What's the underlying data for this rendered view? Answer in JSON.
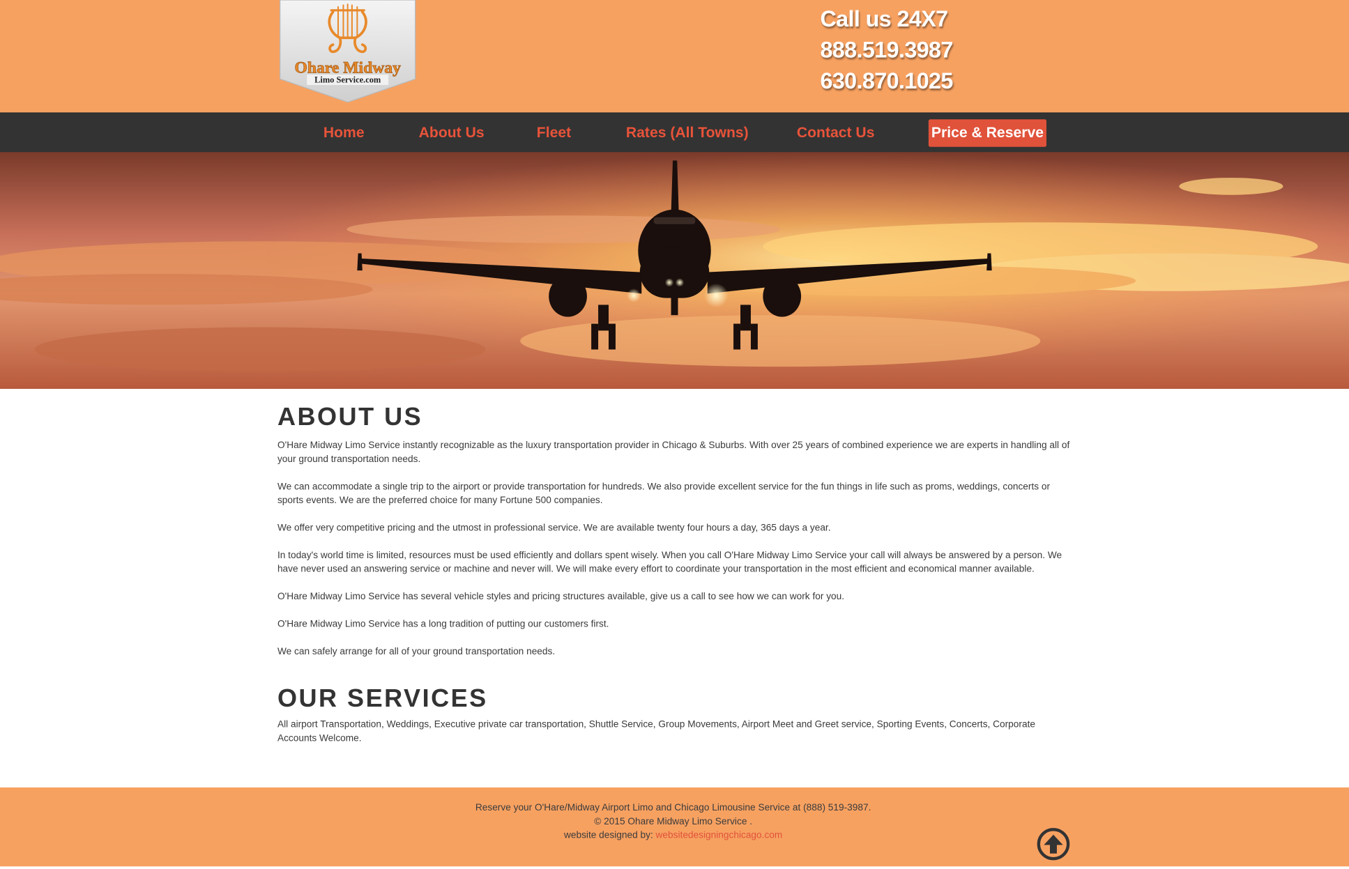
{
  "header": {
    "logo": {
      "line1": "Ohare Midway",
      "line2": "Limo Service.com"
    },
    "call_label": "Call us 24X7",
    "phone1": "888.519.3987",
    "phone2": "630.870.1025"
  },
  "nav": {
    "items": [
      {
        "label": "Home"
      },
      {
        "label": "About Us"
      },
      {
        "label": "Fleet"
      },
      {
        "label": "Rates (All Towns)"
      },
      {
        "label": "Contact Us"
      }
    ],
    "cta": "Price & Reserve"
  },
  "about": {
    "title": "ABOUT US",
    "paragraphs": [
      "O'Hare Midway Limo Service instantly recognizable as the luxury transportation provider in Chicago & Suburbs. With over 25 years of combined experience we are experts in handling all of your ground transportation needs.",
      "We can accommodate a single trip to the airport or provide transportation for hundreds. We also provide excellent service for the fun things in life such as proms, weddings, concerts or sports events. We are the preferred choice for many Fortune 500 companies.",
      "We offer very competitive pricing and the utmost in professional service. We are available twenty four hours a day, 365 days a year.",
      "In today's world time is limited, resources must be used efficiently and dollars spent wisely. When you call O'Hare Midway Limo Service your call will always be answered by a person. We have never used an answering service or machine and never will. We will make every effort to coordinate your transportation in the most efficient and economical manner available.",
      "O'Hare Midway Limo Service has several vehicle styles and pricing structures available, give us a call to see how we can work for you.",
      "O'Hare Midway Limo Service has a long tradition of putting our customers first.",
      "We can safely arrange for all of your ground transportation needs."
    ]
  },
  "services": {
    "title": "OUR SERVICES",
    "text": "All airport Transportation, Weddings, Executive private car transportation, Shuttle Service, Group Movements, Airport Meet and Greet service, Sporting Events, Concerts, Corporate Accounts Welcome."
  },
  "footer": {
    "line1": "Reserve your O'Hare/Midway Airport Limo and Chicago Limousine Service at (888) 519-3987.",
    "line2": "© 2015 Ohare Midway Limo Service .",
    "designed_label": "website designed by:",
    "designed_link": "websitedesigningchicago.com"
  },
  "icons": {
    "logo": "lyre-logo-icon",
    "scroll_top": "arrow-up-circle-icon"
  },
  "colors": {
    "header_bg": "#f7a161",
    "nav_bg": "#333333",
    "nav_text": "#e8533a",
    "cta_bg": "#e0523a"
  }
}
